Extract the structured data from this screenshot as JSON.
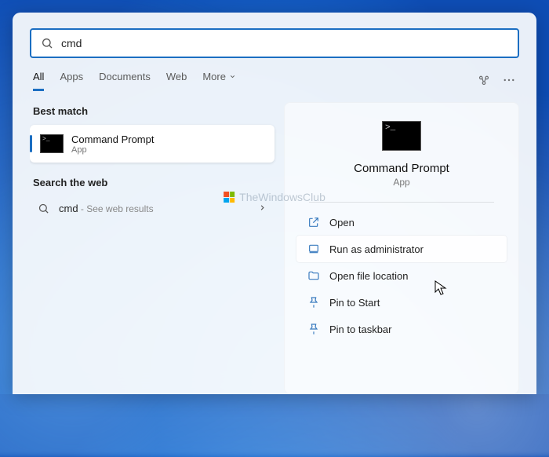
{
  "search": {
    "value": "cmd"
  },
  "tabs": {
    "all": "All",
    "apps": "Apps",
    "documents": "Documents",
    "web": "Web",
    "more": "More"
  },
  "left": {
    "best_match_label": "Best match",
    "result": {
      "title": "Command Prompt",
      "subtitle": "App"
    },
    "search_web_label": "Search the web",
    "web_result": {
      "term": "cmd",
      "hint": " - See web results"
    }
  },
  "right": {
    "title": "Command Prompt",
    "subtitle": "App",
    "actions": {
      "open": "Open",
      "run_admin": "Run as administrator",
      "open_location": "Open file location",
      "pin_start": "Pin to Start",
      "pin_taskbar": "Pin to taskbar"
    }
  },
  "watermark": "TheWindowsClub"
}
